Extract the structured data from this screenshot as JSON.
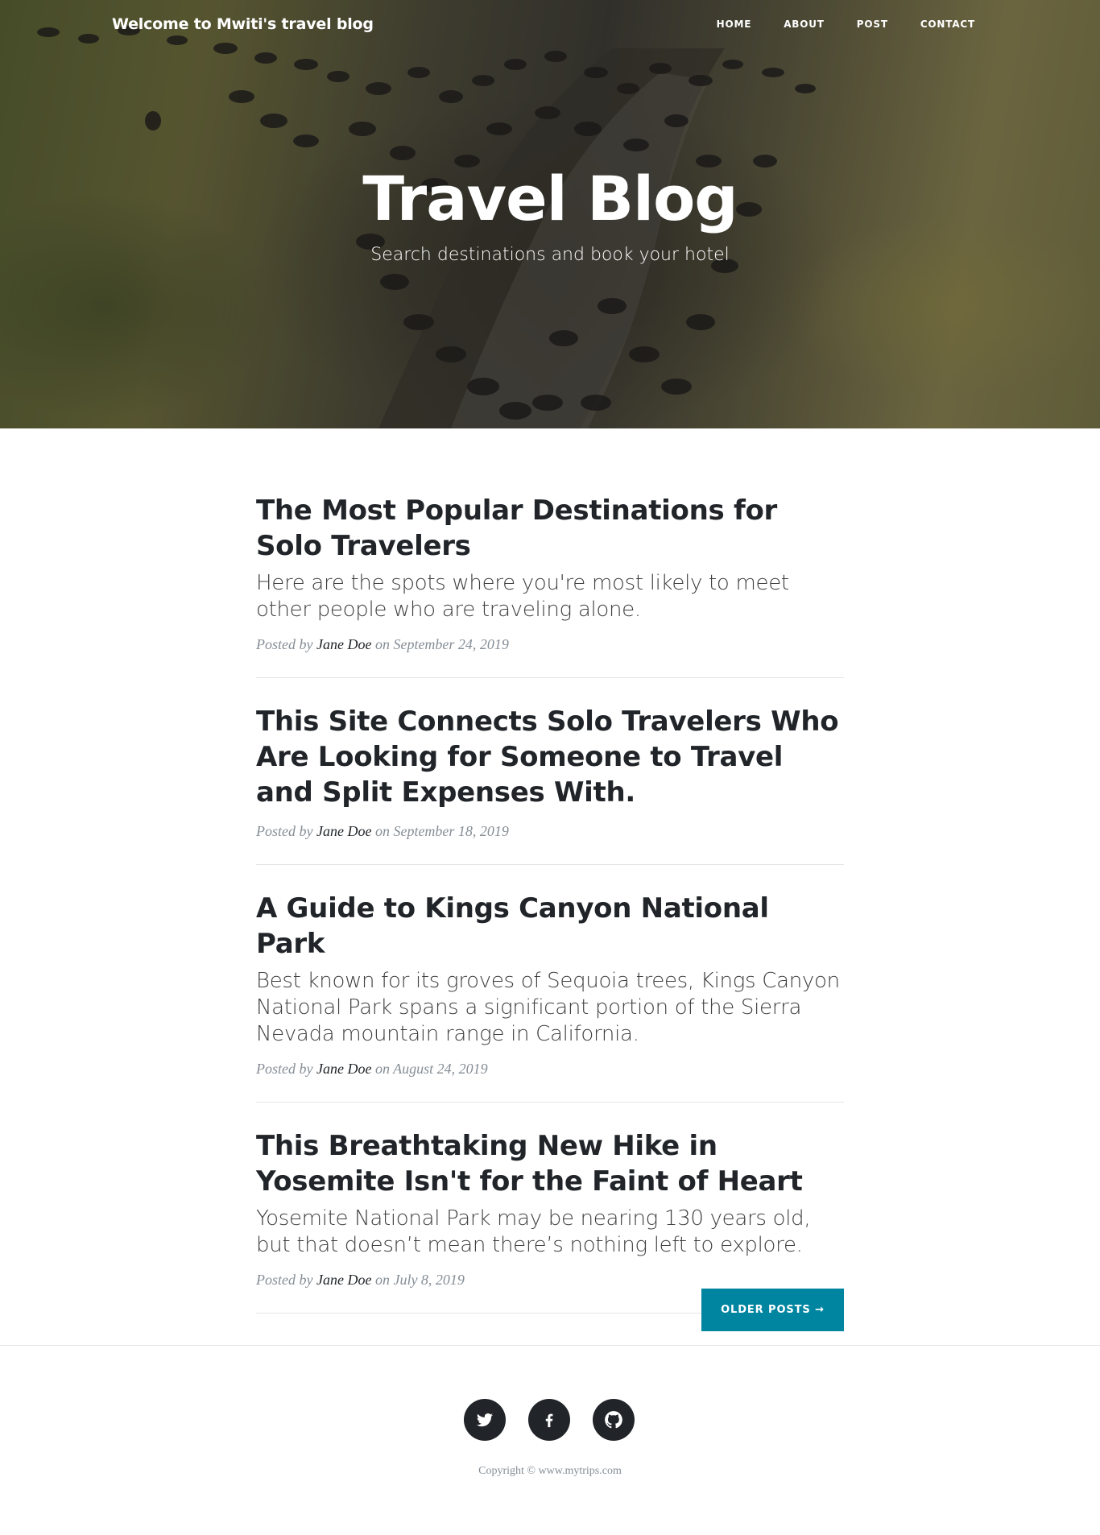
{
  "nav": {
    "brand": "Welcome to Mwiti's travel blog",
    "links": [
      "Home",
      "About",
      "Post",
      "Contact"
    ]
  },
  "hero": {
    "title": "Travel Blog",
    "subtitle": "Search destinations and book your hotel"
  },
  "posts": [
    {
      "title": "The Most Popular Destinations for Solo Travelers",
      "subtitle": "Here are the spots where you're most likely to meet other people who are traveling alone.",
      "posted_by": "Posted by",
      "author": "Jane Doe",
      "on": "on",
      "date": "September 24, 2019"
    },
    {
      "title": "This Site Connects Solo Travelers Who Are Looking for Someone to Travel and Split Expenses With.",
      "subtitle": "",
      "posted_by": "Posted by",
      "author": "Jane Doe",
      "on": "on",
      "date": "September 18, 2019"
    },
    {
      "title": "A Guide to Kings Canyon National Park",
      "subtitle": "Best known for its groves of Sequoia trees, Kings Canyon National Park spans a significant portion of the Sierra Nevada mountain range in California.",
      "posted_by": "Posted by",
      "author": "Jane Doe",
      "on": "on",
      "date": "August 24, 2019"
    },
    {
      "title": "This Breathtaking New Hike in Yosemite Isn't for the Faint of Heart",
      "subtitle": "Yosemite National Park may be nearing 130 years old, but that doesn’t mean there’s nothing left to explore.",
      "posted_by": "Posted by",
      "author": "Jane Doe",
      "on": "on",
      "date": "July 8, 2019"
    }
  ],
  "pager": {
    "older_label": "Older Posts →"
  },
  "footer": {
    "social_icons": [
      "twitter-icon",
      "facebook-icon",
      "github-icon"
    ],
    "copyright": "Copyright © www.mytrips.com"
  },
  "colors": {
    "accent": "#0085a1",
    "text": "#212529",
    "meta": "#868e96"
  }
}
